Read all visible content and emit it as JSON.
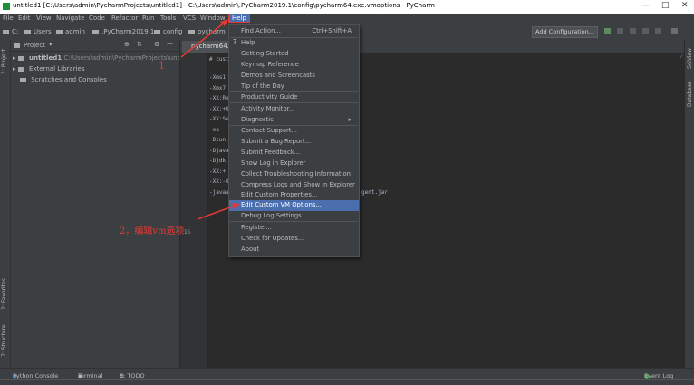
{
  "window": {
    "title": "untitled1 [C:\\Users\\admin\\PycharmProjects\\untitled1] - C:\\Users\\admin\\.PyCharm2019.1\\config\\pycharm64.exe.vmoptions - PyCharm",
    "controls": [
      "—",
      "□",
      "✕"
    ]
  },
  "menubar": [
    "File",
    "Edit",
    "View",
    "Navigate",
    "Code",
    "Refactor",
    "Run",
    "Tools",
    "VCS",
    "Window",
    "Help"
  ],
  "breadcrumbs": [
    "C:",
    "Users",
    "admin",
    ".PyCharm2019.1",
    "config",
    "pycharm"
  ],
  "toolbar": {
    "add_configuration": "Add Configuration..."
  },
  "project_panel": {
    "title": "Project",
    "tree": [
      {
        "name": "untitled1",
        "path": "C:\\Users\\admin\\PycharmProjects\\untitled1"
      },
      {
        "name": "External Libraries"
      },
      {
        "name": "Scratches and Consoles"
      }
    ]
  },
  "left_stripe": [
    "1: Project",
    "2: Favorites",
    "7: Structure"
  ],
  "right_stripe": [
    "SciView",
    "Database"
  ],
  "editor": {
    "tab": "pycharm64.e",
    "lines": [
      "# cust",
      "-Xms1",
      "-Xmx7",
      "-XX:Re",
      "-XX:+U",
      "-XX:So",
      "-ea",
      "-Dsun.",
      "-Djava",
      "-Djdk.",
      "-XX:+",
      "-XX:-O",
      "-javaa"
    ],
    "line_tail": "gent.jar",
    "line_number": "15"
  },
  "help_menu": {
    "items": [
      {
        "label": "Find Action...",
        "shortcut": "Ctrl+Shift+A"
      },
      {
        "label": "Help",
        "icon": "question-icon"
      },
      {
        "label": "Getting Started"
      },
      {
        "label": "Keymap Reference"
      },
      {
        "label": "Demos and Screencasts"
      },
      {
        "label": "Tip of the Day"
      },
      {
        "label": "Productivity Guide"
      },
      {
        "label": "Activity Monitor..."
      },
      {
        "label": "Diagnostic",
        "submenu": true
      },
      {
        "label": "Contact Support..."
      },
      {
        "label": "Submit a Bug Report..."
      },
      {
        "label": "Submit Feedback..."
      },
      {
        "label": "Show Log in Explorer"
      },
      {
        "label": "Collect Troubleshooting Information"
      },
      {
        "label": "Compress Logs and Show in Explorer"
      },
      {
        "label": "Edit Custom Properties..."
      },
      {
        "label": "Edit Custom VM Options...",
        "selected": true
      },
      {
        "label": "Debug Log Settings..."
      },
      {
        "label": "Register..."
      },
      {
        "label": "Check for Updates..."
      },
      {
        "label": "About"
      }
    ]
  },
  "annotations": {
    "step1": "1",
    "step2": "2，编辑vm选项"
  },
  "bottom_tools": [
    "Python Console",
    "Terminal",
    "6: TODO"
  ],
  "event_log": "Event Log",
  "colors": {
    "accent": "#4b6eaf",
    "annotation": "#e53935",
    "panel": "#3c3f41",
    "editor": "#2b2b2b"
  }
}
